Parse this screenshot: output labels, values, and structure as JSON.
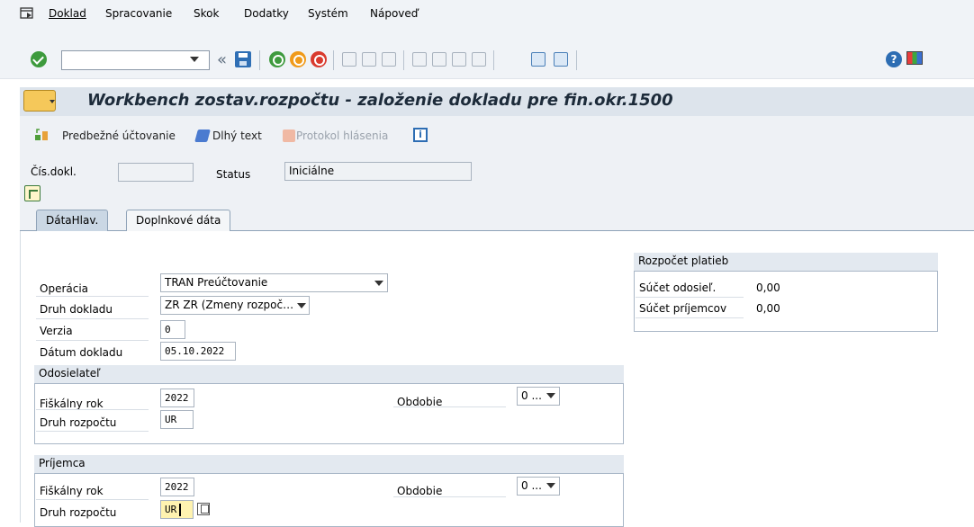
{
  "menu": {
    "items": [
      {
        "label": "Doklad",
        "mnemonic": "D",
        "rest": "oklad"
      },
      {
        "label": "Spracovanie",
        "mnemonic": "p",
        "rest": "racovanie",
        "prefix": "S"
      },
      {
        "label": "Skok",
        "mnemonic": "o",
        "prefix": "Sk",
        "rest": "k"
      },
      {
        "label": "Dodatky",
        "mnemonic": "a",
        "prefix": "Dod",
        "rest": "tky"
      },
      {
        "label": "Systém",
        "mnemonic": "y",
        "prefix": "S",
        "rest": "stém"
      },
      {
        "label": "Nápoveď",
        "mnemonic": "N",
        "prefix": "",
        "rest": "ápoveď"
      }
    ]
  },
  "toolbar": {
    "command_field_value": "",
    "back_arrows": "«"
  },
  "title": "Workbench zostav.rozpočtu - založenie dokladu pre fin.okr.1500",
  "app_toolbar": {
    "prelim_post": "Predbežné účtovanie",
    "long_text": "Dlhý text",
    "message_log": "Protokol hlásenia"
  },
  "header": {
    "doc_no_label": "Čís.dokl.",
    "doc_no_value": "",
    "status_label": "Status",
    "status_value": "Iniciálne"
  },
  "tabs": [
    {
      "label": "DátaHlav.",
      "active": true
    },
    {
      "label": "Doplnkové dáta",
      "active": false
    }
  ],
  "main": {
    "operation_label": "Operácia",
    "operation_value": "TRAN Preúčtovanie",
    "doctype_label": "Druh dokladu",
    "doctype_value": "ZR ZR (Zmeny rozpoč…",
    "version_label": "Verzia",
    "version_value": "0",
    "docdate_label": "Dátum dokladu",
    "docdate_value": "05.10.2022"
  },
  "sender": {
    "title": "Odosielateľ",
    "fy_label": "Fiškálny rok",
    "fy_value": "2022",
    "btype_label": "Druh rozpočtu",
    "btype_value": "UR",
    "period_label": "Obdobie",
    "period_value": "0 ..."
  },
  "receiver": {
    "title": "Príjemca",
    "fy_label": "Fiškálny rok",
    "fy_value": "2022",
    "btype_label": "Druh rozpočtu",
    "btype_value": "UR",
    "period_label": "Obdobie",
    "period_value": "0 ..."
  },
  "payment_budget": {
    "title": "Rozpočet platieb",
    "sender_sum_label": "Súčet odosieľ.",
    "sender_sum_value": "0,00",
    "receiver_sum_label": "Súčet príjemcov",
    "receiver_sum_value": "0,00"
  },
  "colors": {
    "accent_check": "#3d9a3d",
    "title_bar": "#dde4ec",
    "active_tab": "#cad7e4",
    "focus_field": "#fff3b0"
  }
}
